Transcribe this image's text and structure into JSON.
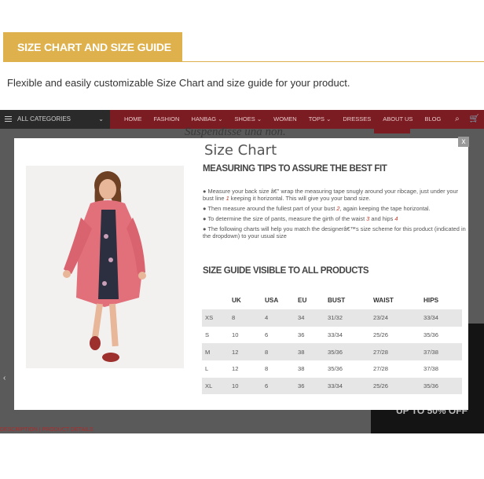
{
  "banner": {
    "title": "SIZE CHART AND SIZE GUIDE"
  },
  "intro": "Flexible and easily customizable Size Chart and size guide for your product.",
  "store": {
    "categories_label": "ALL CATEGORIES",
    "nav": [
      "HOME",
      "FASHION",
      "HANBAG ⌄",
      "SHOES ⌄",
      "WOMEN",
      "TOPS ⌄",
      "DRESSES",
      "ABOUT US",
      "BLOG"
    ],
    "bg_heading": "Suspendisse una non.",
    "sale_text": "UP TO 50% OFF",
    "tabs_text": "DESCRIPTION  |  PRODUCT DETAILS"
  },
  "modal": {
    "close": "x",
    "title": "Size Chart",
    "tips_heading": "MEASURING TIPS TO ASSURE THE BEST FIT",
    "tips": [
      {
        "text": "Measure your back size â€\" wrap the measuring tape snugly around your ribcage, just under your bust line ",
        "red": "1",
        "after": " keeping it horizontal. This will give you your band size."
      },
      {
        "text": "Then measure around the fullest part of your bust ",
        "red": "2",
        "after": ", again keeping the tape horizontal."
      },
      {
        "text": "To determine the size of pants, measure the girth of the waist ",
        "red": "3",
        "after": " and hips ",
        "red2": "4"
      },
      {
        "text": "The following charts will help you match the designerâ€™s size scheme for this product (indicated in the dropdown) to your usual size",
        "red": "",
        "after": ""
      }
    ],
    "guide_heading": "SIZE GUIDE VISIBLE TO ALL PRODUCTS",
    "table": {
      "headers": [
        "",
        "UK",
        "USA",
        "EU",
        "BUST",
        "WAIST",
        "HIPS"
      ],
      "rows": [
        [
          "XS",
          "8",
          "4",
          "34",
          "31/32",
          "23/24",
          "33/34"
        ],
        [
          "S",
          "10",
          "6",
          "36",
          "33/34",
          "25/26",
          "35/36"
        ],
        [
          "M",
          "12",
          "8",
          "38",
          "35/36",
          "27/28",
          "37/38"
        ],
        [
          "L",
          "12",
          "8",
          "38",
          "35/36",
          "27/28",
          "37/38"
        ],
        [
          "XL",
          "10",
          "6",
          "36",
          "33/34",
          "25/26",
          "35/36"
        ]
      ]
    }
  },
  "colors": {
    "accent": "#dfb14d",
    "nav_bg": "#7b1b22"
  }
}
